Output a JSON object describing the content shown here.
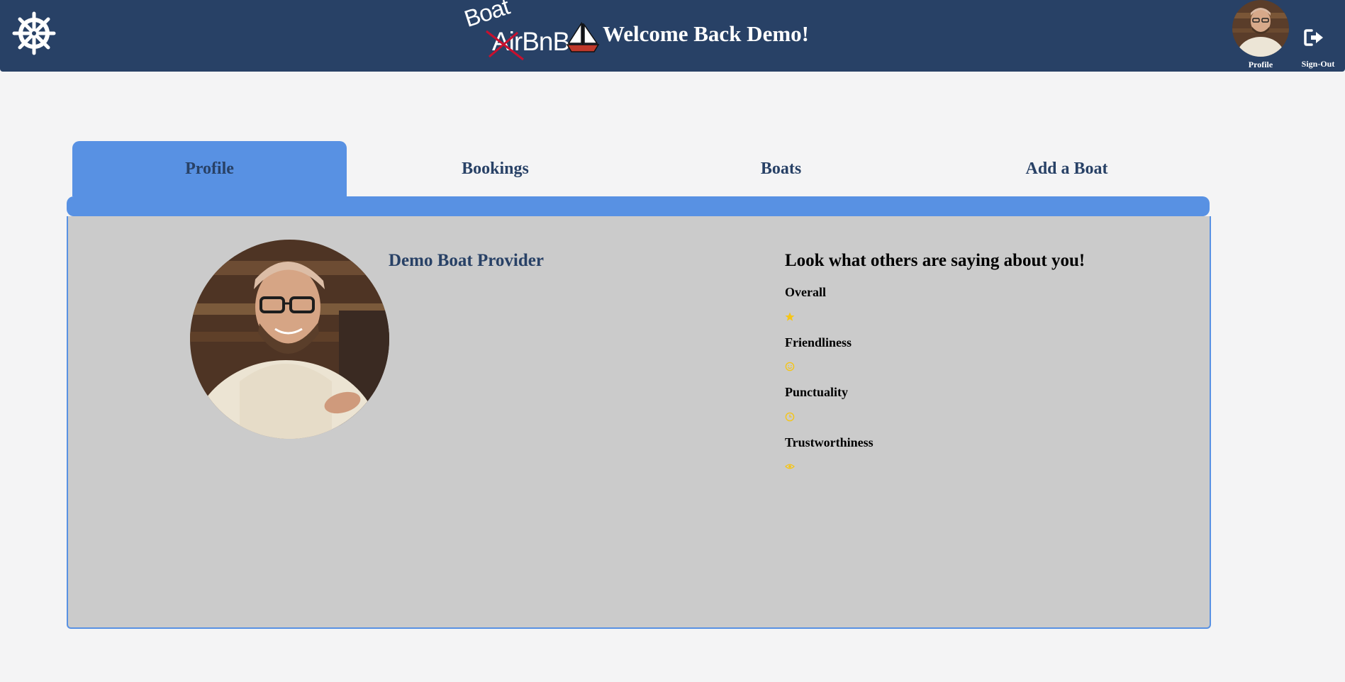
{
  "header": {
    "logo": {
      "top_word": "Boat",
      "struck_word": "AirBnB"
    },
    "welcome": "Welcome Back Demo!",
    "profile_label": "Profile",
    "signout_label": "Sign-Out"
  },
  "tabs": [
    {
      "label": "Profile",
      "active": true
    },
    {
      "label": "Bookings",
      "active": false
    },
    {
      "label": "Boats",
      "active": false
    },
    {
      "label": "Add a Boat",
      "active": false
    }
  ],
  "profile": {
    "name": "Demo Boat Provider",
    "reviews_heading": "Look what others are saying about you!",
    "ratings": [
      {
        "label": "Overall",
        "icon": "star-icon",
        "value": 1
      },
      {
        "label": "Friendliness",
        "icon": "smile-icon",
        "value": 1
      },
      {
        "label": "Punctuality",
        "icon": "clock-icon",
        "value": 1
      },
      {
        "label": "Trustworthiness",
        "icon": "eye-icon",
        "value": 1
      }
    ]
  },
  "colors": {
    "header_bg": "#284166",
    "accent": "#5891e3",
    "panel_bg": "#cbcbcb",
    "rating_icon": "#f5c518",
    "logo_strike": "#c8102e",
    "boat_hull": "#c0392b"
  }
}
